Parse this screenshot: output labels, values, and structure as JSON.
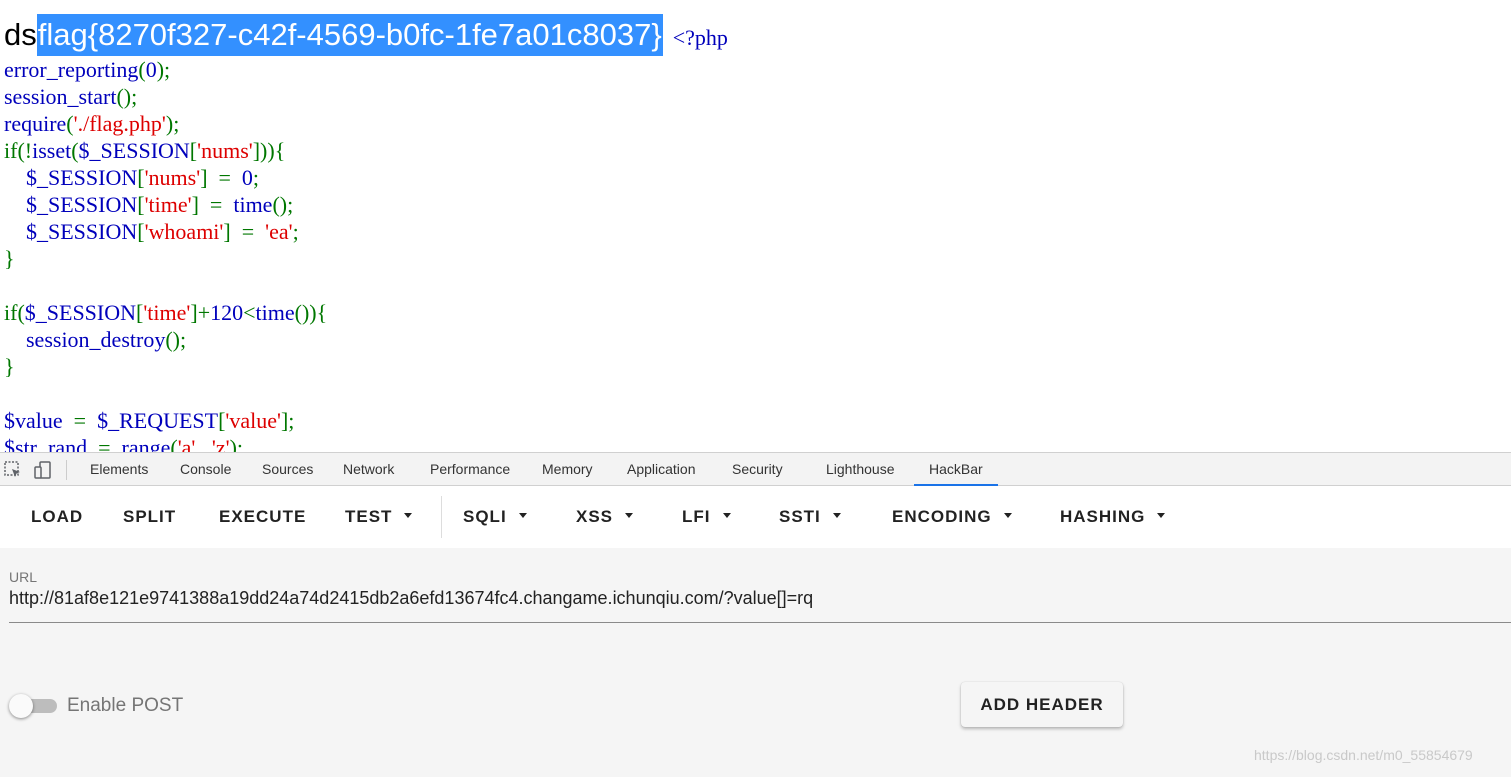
{
  "page": {
    "prefix_text": "ds",
    "flag_text": "flag{8270f327-c42f-4569-b0fc-1fe7a01c8037}",
    "php_open": "<?php"
  },
  "devtools": {
    "tabs": [
      "Elements",
      "Console",
      "Sources",
      "Network",
      "Performance",
      "Memory",
      "Application",
      "Security",
      "Lighthouse",
      "HackBar"
    ],
    "active_tab": "HackBar"
  },
  "hackbar": {
    "buttons": [
      "LOAD",
      "SPLIT",
      "EXECUTE",
      "TEST",
      "SQLI",
      "XSS",
      "LFI",
      "SSTI",
      "ENCODING",
      "HASHING"
    ],
    "url_label": "URL",
    "url_value": "http://81af8e121e9741388a19dd24a74d2415db2a6efd13674fc4.changame.ichunqiu.com/?value[]=rq",
    "enable_post_label": "Enable POST",
    "enable_post_on": false,
    "add_header_label": "ADD HEADER"
  },
  "watermark": "https://blog.csdn.net/m0_55854679",
  "colors": {
    "selection": "#3390ff",
    "php_keyword": "#0000bb",
    "php_punct": "#007700",
    "php_string": "#dd0000",
    "active_tab_underline": "#1a73e8"
  },
  "icons": [
    "inspect-element-icon",
    "device-toolbar-icon"
  ]
}
